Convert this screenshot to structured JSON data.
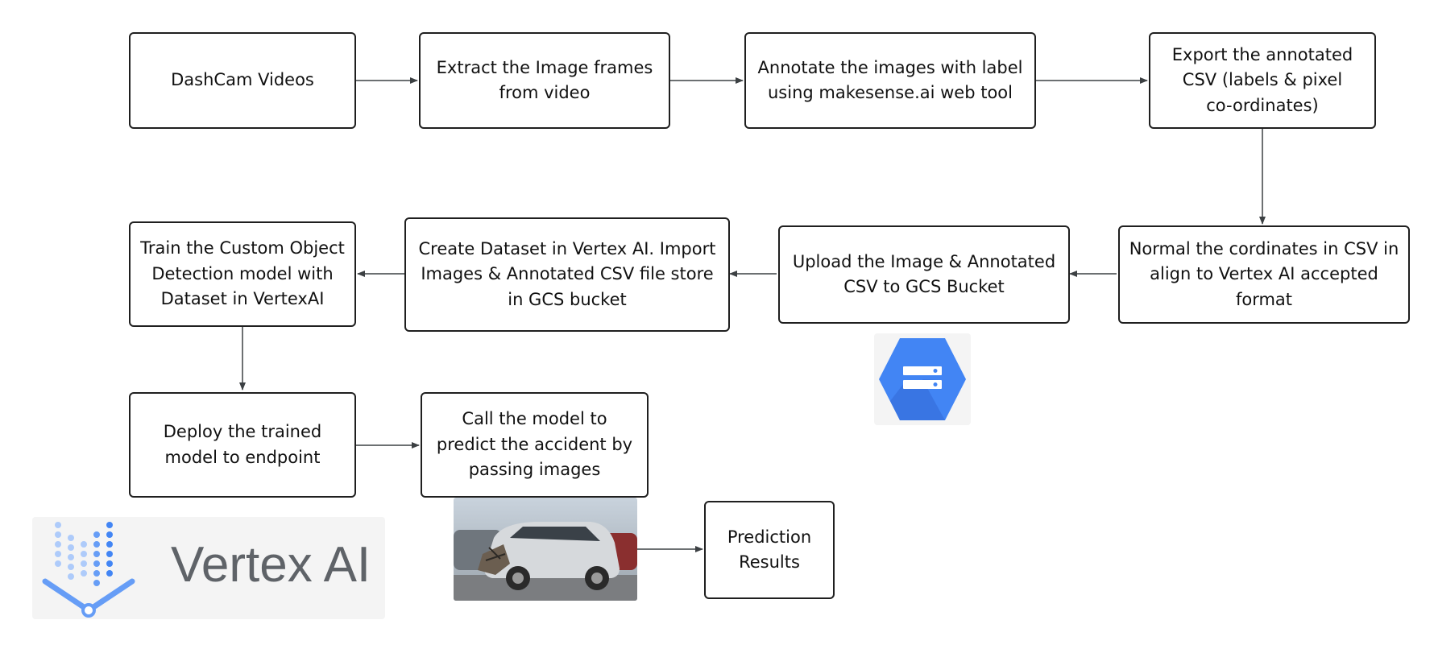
{
  "colors": {
    "border": "#1f1f1f",
    "arrow": "#3c4043",
    "gcs_blue": "#4285f4",
    "vertex_blue": "#4285f4"
  },
  "nodes": {
    "dashcam": "DashCam Videos",
    "extract": "Extract the Image frames\nfrom video",
    "annotate": "Annotate the images with label\nusing makesense.ai web tool",
    "export": "Export the annotated\nCSV (labels & pixel\nco-ordinates)",
    "normalize": "Normal the cordinates in CSV in\nalign to Vertex AI accepted\nformat",
    "upload": "Upload the Image & Annotated\nCSV to GCS Bucket",
    "create_dataset": "Create Dataset in Vertex AI. Import\nImages & Annotated CSV file store\nin GCS bucket",
    "train": "Train the Custom Object\nDetection model with\nDataset in VertexAI",
    "deploy": "Deploy the trained\nmodel to endpoint",
    "call_model": "Call the model to\npredict the accident by\npassing images",
    "prediction": "Prediction\nResults"
  },
  "logos": {
    "vertex_ai": "Vertex AI",
    "gcs_icon": "cloud-storage-icon"
  },
  "images": {
    "accident_photo": "damaged-car-photo"
  }
}
